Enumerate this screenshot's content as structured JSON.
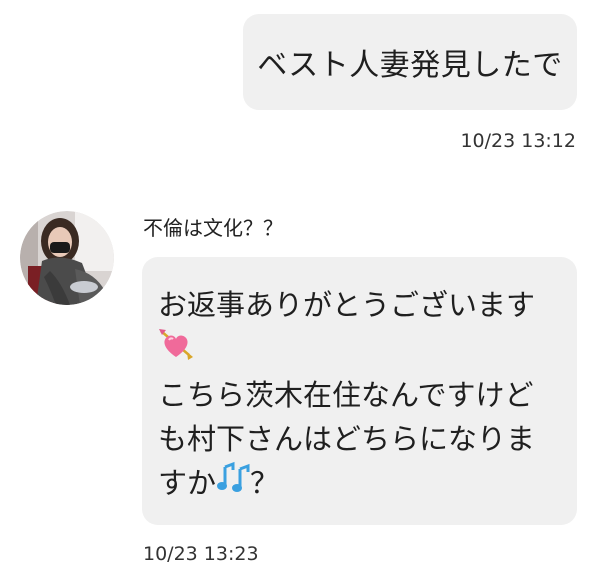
{
  "outgoing_message": {
    "text": "ベスト人妻発見したで",
    "time": "10/23 13:12"
  },
  "incoming_message": {
    "sender_name": "不倫は文化？？",
    "avatar": "profile-photo",
    "lines": [
      "お返事ありがとうございます",
      "",
      "こちら茨木在住なんですけど",
      "も村下さんはどちらになりま",
      "すか"
    ],
    "line5_suffix": "？",
    "time": "10/23 13:23"
  },
  "icons": [
    "heart-with-arrow-emoji",
    "musical-notes-emoji"
  ],
  "colors": {
    "bubble_bg": "#f0f0f0",
    "text": "#1f1f1f",
    "background": "#ffffff"
  }
}
